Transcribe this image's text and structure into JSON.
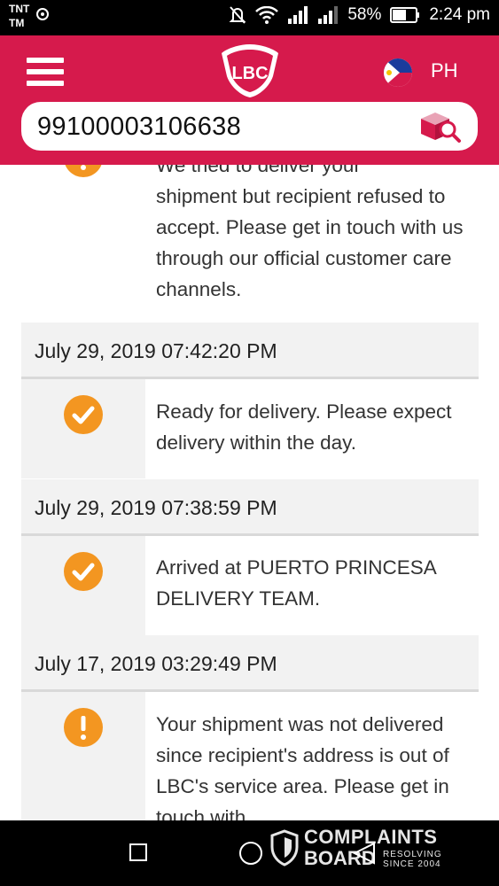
{
  "status_bar": {
    "carrier_line1": "TNT",
    "carrier_line2": "TM",
    "battery": "58%",
    "time": "2:24 pm"
  },
  "header": {
    "logo_text": "LBC",
    "region": "PH",
    "brand_color": "#d61a4c"
  },
  "search": {
    "tracking_number": "99100003106638"
  },
  "timeline": {
    "top_partial_message_line1": "We tried to deliver your",
    "top_partial_message_rest": "shipment but recipient refused to accept. Please get in touch with us through our official customer care channels.",
    "entries": [
      {
        "date": "July 29, 2019 07:42:20 PM",
        "status": "check",
        "message": "Ready for delivery. Please expect delivery within the day."
      },
      {
        "date": "July 29, 2019 07:38:59 PM",
        "status": "check",
        "message": "Arrived at PUERTO PRINCESA DELIVERY TEAM."
      },
      {
        "date": "July 17, 2019 03:29:49 PM",
        "status": "alert",
        "message": "Your shipment was not delivered since recipient's address is out of LBC's service area. Please get in touch with"
      }
    ],
    "status_icon_color": "#f39621"
  },
  "watermark": {
    "title": "COMPLAINTS",
    "subtitle": "BOARD",
    "tagline1": "RESOLVING",
    "tagline2": "SINCE 2004"
  }
}
